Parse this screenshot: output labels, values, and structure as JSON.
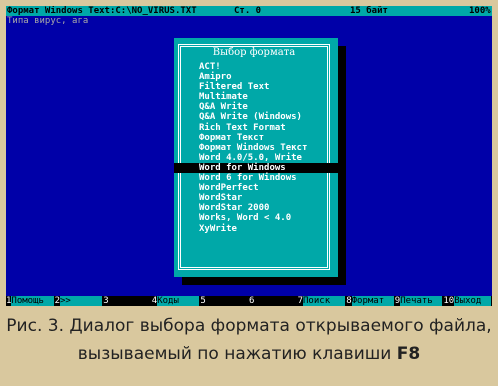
{
  "statusbar": {
    "filename": "Формат Windows Text:C:\\NO_VIRUS.TXT",
    "line": "Ст. 0",
    "size": "15 байт",
    "percent": "100%"
  },
  "document": {
    "line1": "Типа вирус, ага"
  },
  "dialog": {
    "title": "Выбор формата",
    "selected_index": 10,
    "items": [
      "ACT!",
      "Amipro",
      "Filtered Text",
      "Multimate",
      "Q&A Write",
      "Q&A Write (Windows)",
      "Rich Text Format",
      "Формат Текст",
      "Формат Windows Текст",
      "Word 4.0/5.0, Write",
      "Word for Windows",
      "Word 6 for Windows",
      "WordPerfect",
      "WordStar",
      "WordStar 2000",
      "Works, Word < 4.0",
      "XyWrite"
    ]
  },
  "fkeys": [
    {
      "num": "1",
      "label": "Помощь"
    },
    {
      "num": "2",
      "label": ">>"
    },
    {
      "num": "3",
      "label": ""
    },
    {
      "num": "4",
      "label": "Коды"
    },
    {
      "num": "5",
      "label": ""
    },
    {
      "num": "6",
      "label": ""
    },
    {
      "num": "7",
      "label": "Поиск"
    },
    {
      "num": "8",
      "label": "Формат"
    },
    {
      "num": "9",
      "label": "Печать"
    },
    {
      "num": "10",
      "label": "Выход"
    }
  ],
  "caption": {
    "text": "Рис. 3. Диалог выбора формата открываемого файла, вызываемый по нажатию клавиши ",
    "key": "F8"
  }
}
